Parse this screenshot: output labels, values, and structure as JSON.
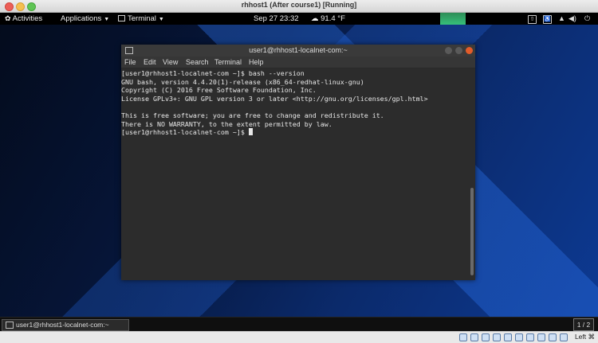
{
  "host": {
    "title": "rhhost1 (After course1) [Running]"
  },
  "topbar": {
    "activities": "Activities",
    "applications": "Applications",
    "terminal_menu": "Terminal",
    "datetime": "Sep 27  23:32",
    "weather": "91.4 °F"
  },
  "terminal": {
    "title": "user1@rhhost1-localnet-com:~",
    "menu": [
      "File",
      "Edit",
      "View",
      "Search",
      "Terminal",
      "Help"
    ],
    "lines": [
      "[user1@rhhost1-localnet-com ~]$ bash --version",
      "GNU bash, version 4.4.20(1)-release (x86_64-redhat-linux-gnu)",
      "Copyright (C) 2016 Free Software Foundation, Inc.",
      "License GPLv3+: GNU GPL version 3 or later <http://gnu.org/licenses/gpl.html>",
      "",
      "This is free software; you are free to change and redistribute it.",
      "There is NO WARRANTY, to the extent permitted by law."
    ],
    "prompt": "[user1@rhhost1-localnet-com ~]$ "
  },
  "taskbar": {
    "window_label": "user1@rhhost1-localnet-com:~",
    "workspace": "1 / 2"
  },
  "host_status": {
    "host_key": "Left ⌘"
  },
  "colors": {
    "close_button": "#e25c2a",
    "indicator": "#36c07a"
  }
}
